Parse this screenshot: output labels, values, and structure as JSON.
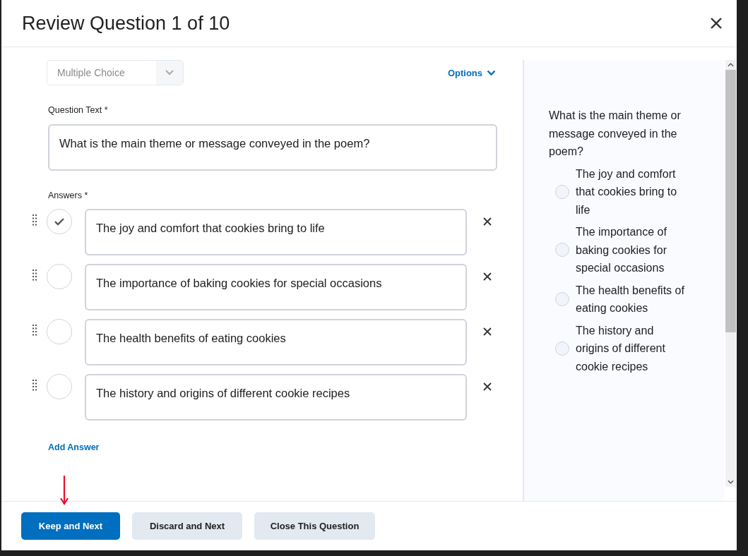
{
  "dialog": {
    "title": "Review Question 1 of 10"
  },
  "question_type": {
    "value": "Multiple Choice",
    "disabled": true
  },
  "options_link": "Options",
  "question_text": {
    "label": "Question Text *",
    "value": "What is the main theme or message conveyed in the poem?"
  },
  "answers": {
    "label": "Answers *",
    "items": [
      {
        "text": "The joy and comfort that cookies bring to life",
        "checked": true
      },
      {
        "text": "The importance of baking cookies for special occasions",
        "checked": false
      },
      {
        "text": "The health benefits of eating cookies",
        "checked": false
      },
      {
        "text": "The history and origins of different cookie recipes",
        "checked": false
      }
    ]
  },
  "add_answer": "Add Answer",
  "preview": {
    "question": "What is the main theme or message conveyed in the poem?",
    "options": [
      {
        "text": "The joy and comfort that cookies bring to life",
        "selected": false
      },
      {
        "text": "The importance of baking cookies for special occasions",
        "selected": false
      },
      {
        "text": "The health benefits of eating cookies",
        "selected": false
      },
      {
        "text": "The history and origins of different cookie recipes",
        "selected": false
      }
    ]
  },
  "footer_buttons": [
    {
      "label": "Keep and Next",
      "kind": "primary"
    },
    {
      "label": "Discard and Next",
      "kind": "secondary"
    },
    {
      "label": "Close This Question",
      "kind": "secondary"
    }
  ]
}
